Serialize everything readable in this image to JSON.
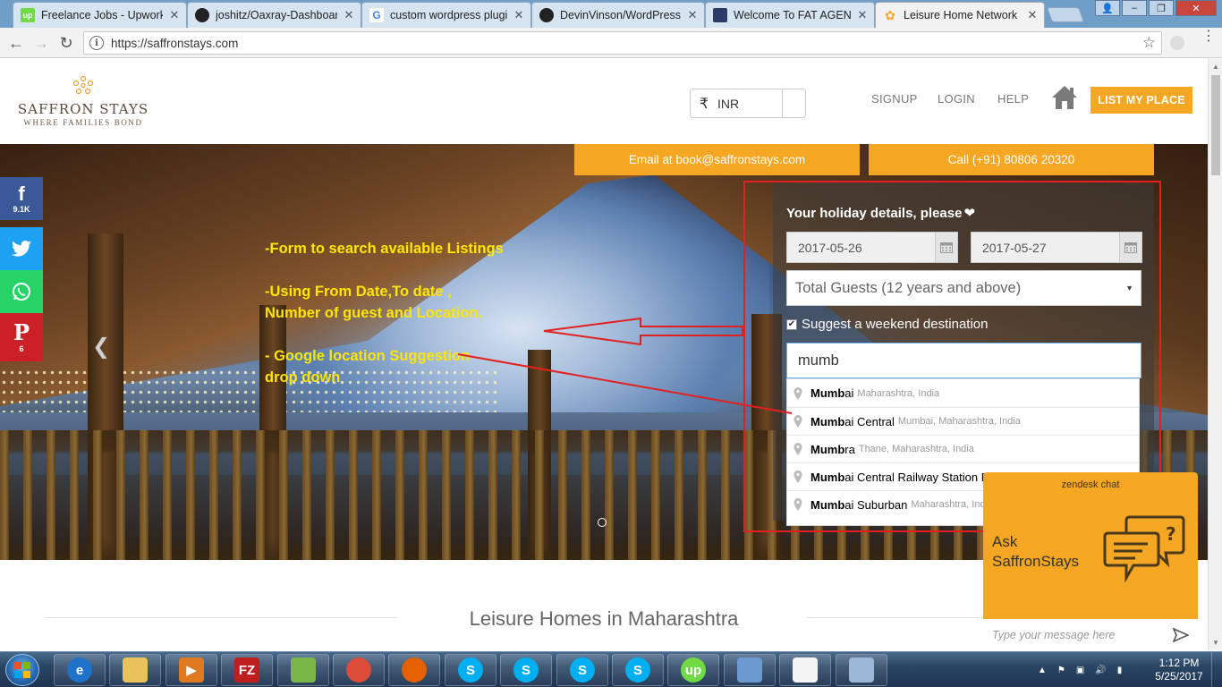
{
  "browser": {
    "tabs": [
      {
        "title": "Freelance Jobs - Upwork",
        "favicon": "upwork-icon",
        "color": "#6fda44"
      },
      {
        "title": "joshitz/Oaxray-Dashboar",
        "favicon": "github-icon",
        "color": "#222222"
      },
      {
        "title": "custom wordpress plugin",
        "favicon": "google-icon",
        "color": "#ffffff"
      },
      {
        "title": "DevinVinson/WordPress-",
        "favicon": "github-icon",
        "color": "#222222"
      },
      {
        "title": "Welcome To FAT AGENT",
        "favicon": "fat-agent-icon",
        "color": "#2b3a66"
      },
      {
        "title": "Leisure Home Network |",
        "favicon": "saffron-icon",
        "color": "#f5a623"
      }
    ],
    "url": "https://saffronstays.com"
  },
  "site": {
    "logo_name": "SAFFRON STAYS",
    "logo_tagline": "WHERE FAMILIES BOND",
    "currency_symbol": "₹",
    "currency_code": "INR",
    "nav": {
      "signup": "SIGNUP",
      "login": "LOGIN",
      "help": "HELP"
    },
    "list_place": "LIST MY PLACE",
    "email_btn": "Email at book@saffronstays.com",
    "call_btn": "Call (+91) 80806 20320",
    "accent": "#f5a623"
  },
  "social": [
    {
      "name": "facebook",
      "glyph": "f",
      "count": "9.1K",
      "color": "#3b5998"
    },
    {
      "name": "twitter",
      "glyph": "",
      "count": "",
      "color": "#1da1f2"
    },
    {
      "name": "whatsapp",
      "glyph": "",
      "count": "",
      "color": "#25d366"
    },
    {
      "name": "pinterest",
      "glyph": "P",
      "count": "6",
      "color": "#cb2027"
    }
  ],
  "annotations": {
    "line1": "-Form to search available Listings",
    "line2": "-Using From Date,To date ,",
    "line3": "Number of guest and Location.",
    "line4": "- Google location Suggestion",
    "line5": "drop down"
  },
  "form": {
    "title": "Your holiday details, please",
    "date_from": "2017-05-26",
    "date_to": "2017-05-27",
    "guests": "Total Guests (12 years and above)",
    "weekend_label": "Suggest a weekend destination",
    "weekend_checked": true,
    "location_value": "mumb"
  },
  "suggestions": [
    {
      "match": "Mumb",
      "rest": "ai",
      "secondary": "Maharashtra, India"
    },
    {
      "match": "Mumb",
      "rest": "ai Central",
      "secondary": "Mumbai, Maharashtra, India"
    },
    {
      "match": "Mumb",
      "rest": "ra",
      "secondary": "Thane, Maharashtra, India"
    },
    {
      "match": "Mumb",
      "rest": "ai Central Railway Station Buildi",
      "secondary": ""
    },
    {
      "match": "Mumb",
      "rest": "ai Suburban",
      "secondary": "Maharashtra, Ind"
    }
  ],
  "section_title": "Leisure Homes in Maharashtra",
  "zendesk": {
    "title": "zendesk chat",
    "ask_line1": "Ask",
    "ask_line2": "SaffronStays",
    "placeholder": "Type your message here"
  },
  "taskbar": {
    "time": "1:12 PM",
    "date": "5/25/2017",
    "apps": [
      {
        "name": "internet-explorer",
        "label": "e",
        "color": "#1e73c8"
      },
      {
        "name": "file-explorer",
        "label": "",
        "color": "#e8c25a"
      },
      {
        "name": "media-player",
        "label": "▶",
        "color": "#e07a20"
      },
      {
        "name": "filezilla",
        "label": "FZ",
        "color": "#bf1e1e"
      },
      {
        "name": "notepad-plus",
        "label": "",
        "color": "#7ab648"
      },
      {
        "name": "chrome",
        "label": "",
        "color": "#dd4b39"
      },
      {
        "name": "firefox",
        "label": "",
        "color": "#e66000"
      },
      {
        "name": "skype-1",
        "label": "S",
        "color": "#00aff0"
      },
      {
        "name": "skype-2",
        "label": "S",
        "color": "#00aff0"
      },
      {
        "name": "skype-3",
        "label": "S",
        "color": "#00aff0"
      },
      {
        "name": "skype-4",
        "label": "S",
        "color": "#00aff0"
      },
      {
        "name": "upwork",
        "label": "up",
        "color": "#6fda44"
      },
      {
        "name": "virtualbox",
        "label": "",
        "color": "#6a9ad0"
      },
      {
        "name": "blank-doc",
        "label": "",
        "color": "#f4f4f4"
      },
      {
        "name": "paint",
        "label": "",
        "color": "#9bb8d8"
      }
    ]
  }
}
